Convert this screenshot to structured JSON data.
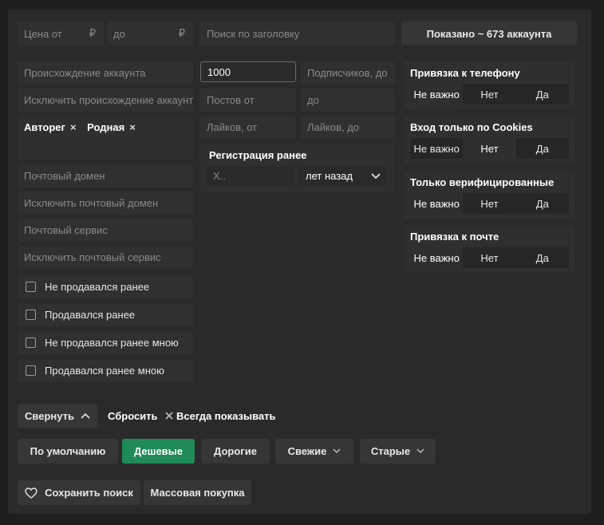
{
  "price": {
    "from_placeholder": "Цена от",
    "to_placeholder": "до",
    "currency": "₽"
  },
  "search": {
    "placeholder": "Поиск по заголовку"
  },
  "shown_button": "Показано ~ 673 аккаунта",
  "origin": {
    "placeholder": "Происхождение аккаунта",
    "exclude_placeholder": "Исключить происхождение аккаунт",
    "tags": [
      {
        "label": "Авторег",
        "remove": "×"
      },
      {
        "label": "Родная",
        "remove": "×"
      }
    ]
  },
  "subscribers": {
    "from_value": "1000",
    "to_placeholder": "Подписчиков, до"
  },
  "posts": {
    "from_placeholder": "Постов от",
    "to_placeholder": "до"
  },
  "likes": {
    "from_placeholder": "Лайков, от",
    "to_placeholder": "Лайков, до"
  },
  "registration": {
    "title": "Регистрация ранее",
    "value_placeholder": "X..",
    "unit": "лет назад"
  },
  "mail": {
    "domain_placeholder": "Почтовый домен",
    "exclude_domain_placeholder": "Исключить почтовый домен",
    "service_placeholder": "Почтовый сервис",
    "exclude_service_placeholder": "Исключить почтовый сервис"
  },
  "checkboxes": [
    "Не продавался ранее",
    "Продавался ранее",
    "Не продавался ранее мною",
    "Продавался ранее мною"
  ],
  "toggles": [
    {
      "title": "Привязка к телефону",
      "options": [
        "Не важно",
        "Нет",
        "Да"
      ],
      "selected": 0
    },
    {
      "title": "Вход только по Cookies",
      "options": [
        "Не важно",
        "Нет",
        "Да"
      ],
      "selected": 1
    },
    {
      "title": "Только верифицированные",
      "options": [
        "Не важно",
        "Нет",
        "Да"
      ],
      "selected": 0
    },
    {
      "title": "Привязка к почте",
      "options": [
        "Не важно",
        "Нет",
        "Да"
      ],
      "selected": 0
    }
  ],
  "actions": {
    "collapse": "Свернуть",
    "reset": "Сбросить",
    "always_show": "Всегда показывать"
  },
  "sort": {
    "default": "По умолчанию",
    "cheap": "Дешевые",
    "expensive": "Дорогие",
    "fresh": "Свежие",
    "old": "Старые"
  },
  "bottom": {
    "save_search": "Сохранить поиск",
    "bulk_buy": "Массовая покупка"
  },
  "colors": {
    "accent_green": "#1f8a55",
    "panel": "#2a2a2a",
    "field": "#303030"
  }
}
